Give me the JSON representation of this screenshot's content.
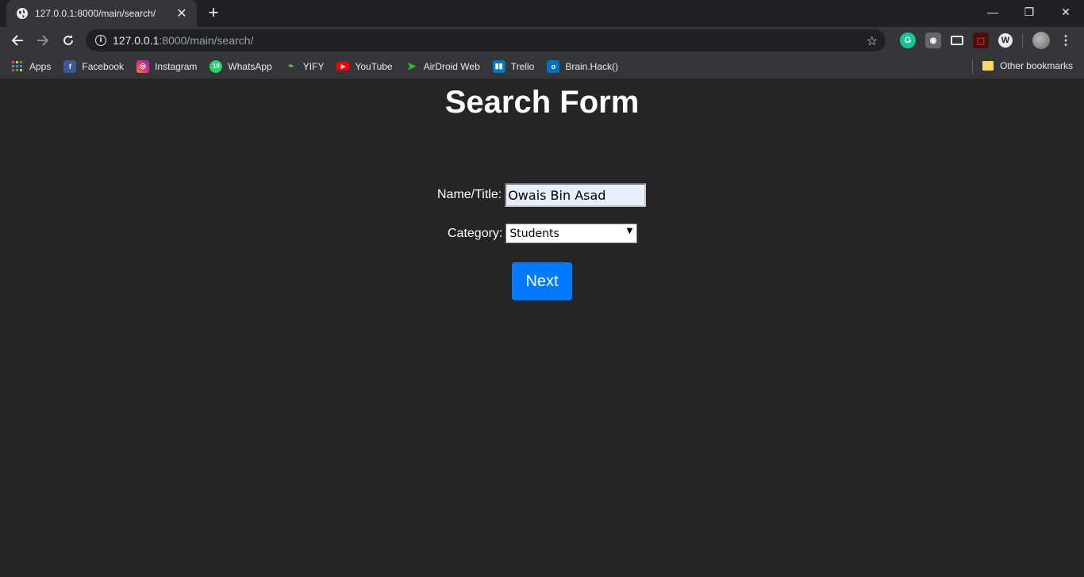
{
  "browser": {
    "tab_title": "127.0.0.1:8000/main/search/",
    "url_host": "127.0.0.1",
    "url_path": ":8000/main/search/",
    "window_controls": {
      "minimize": "—",
      "restore": "❐",
      "close": "✕"
    }
  },
  "bookmarks": {
    "items": [
      {
        "label": "Apps",
        "icon": "apps-grid-icon",
        "color": "#4285f4"
      },
      {
        "label": "Facebook",
        "icon": "facebook-icon",
        "color": "#3b5998"
      },
      {
        "label": "Instagram",
        "icon": "instagram-icon",
        "color": "#c13584"
      },
      {
        "label": "WhatsApp",
        "icon": "whatsapp-icon",
        "color": "#25d366"
      },
      {
        "label": "YIFY",
        "icon": "yify-icon",
        "color": "#6ac045"
      },
      {
        "label": "YouTube",
        "icon": "youtube-icon",
        "color": "#ff0000"
      },
      {
        "label": "AirDroid Web",
        "icon": "airdroid-icon",
        "color": "#2eb82e"
      },
      {
        "label": "Trello",
        "icon": "trello-icon",
        "color": "#0079bf"
      },
      {
        "label": "Brain.Hack()",
        "icon": "outlook-icon",
        "color": "#0072c6"
      }
    ],
    "other": "Other bookmarks"
  },
  "form": {
    "title": "Search Form",
    "name_label": "Name/Title:",
    "name_value": "Owais Bin Asad",
    "category_label": "Category:",
    "category_value": "Students",
    "next_label": "Next",
    "button_color": "#007bff"
  }
}
